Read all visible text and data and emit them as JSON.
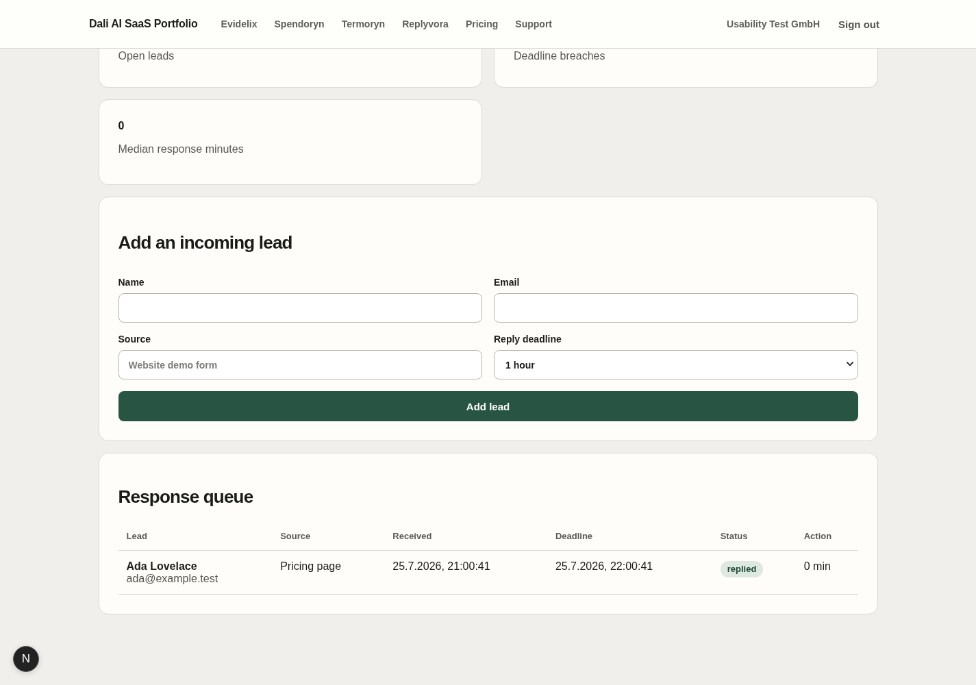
{
  "header": {
    "brand": "Dali AI SaaS Portfolio",
    "nav": [
      "Evidelix",
      "Spendoryn",
      "Termoryn",
      "Replyvora",
      "Pricing",
      "Support"
    ],
    "account": "Usability Test GmbH",
    "sign_out": "Sign out"
  },
  "stats": [
    {
      "label": "Open leads"
    },
    {
      "label": "Deadline breaches"
    },
    {
      "value": "0",
      "label": "Median response minutes"
    }
  ],
  "lead_form": {
    "title": "Add an incoming lead",
    "fields": [
      {
        "kind": "text",
        "label": "Name"
      },
      {
        "kind": "text",
        "label": "Email"
      },
      {
        "kind": "text",
        "label": "Source",
        "placeholder": "Website demo form"
      },
      {
        "kind": "select",
        "label": "Reply deadline",
        "value": "1 hour"
      }
    ],
    "submit": "Add lead"
  },
  "queue": {
    "title": "Response queue",
    "columns": [
      "Lead",
      "Source",
      "Received",
      "Deadline",
      "Status",
      "Action"
    ],
    "rows": [
      {
        "lead": {
          "name": "Ada Lovelace",
          "email": "ada@example.test"
        },
        "source": "Pricing page",
        "received": "25.7.2026, 21:00:41",
        "deadline": "25.7.2026, 22:00:41",
        "status": "replied",
        "action": "0 min"
      }
    ]
  },
  "dev_badge": {
    "label": "N"
  }
}
